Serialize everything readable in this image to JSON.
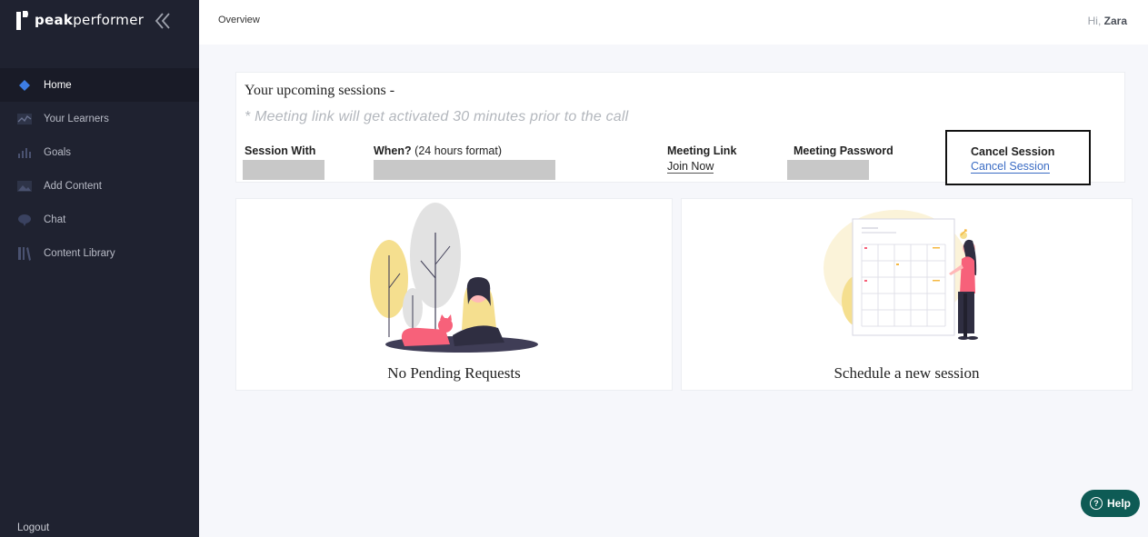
{
  "brand": {
    "name_prefix": "peak",
    "name_suffix": "performer"
  },
  "sidebar": {
    "items": [
      {
        "label": "Home",
        "icon": "diamond-icon",
        "active": true
      },
      {
        "label": "Your Learners",
        "icon": "chart-icon"
      },
      {
        "label": "Goals",
        "icon": "bars-icon"
      },
      {
        "label": "Add Content",
        "icon": "image-icon"
      },
      {
        "label": "Chat",
        "icon": "chat-icon"
      },
      {
        "label": "Content Library",
        "icon": "library-icon"
      }
    ],
    "logout": "Logout"
  },
  "header": {
    "breadcrumb": "Overview",
    "greeting": "Hi,",
    "user": "Zara"
  },
  "sessions": {
    "title": "Your upcoming sessions -",
    "note": "* Meeting link will get activated 30 minutes prior to the call",
    "columns": {
      "with": "Session With",
      "when": "When?",
      "when_hint": "(24 hours format)",
      "link": "Meeting Link",
      "password": "Meeting Password",
      "cancel": "Cancel Session"
    },
    "row": {
      "join": "Join Now",
      "cancel": "Cancel Session"
    }
  },
  "cards": {
    "left": "No Pending Requests",
    "right": "Schedule a new session"
  },
  "help": {
    "label": "Help"
  },
  "colors": {
    "sidebar": "#1f2230",
    "accent": "#3d7de4",
    "help": "#0e5b55",
    "link": "#3b6cc4"
  }
}
